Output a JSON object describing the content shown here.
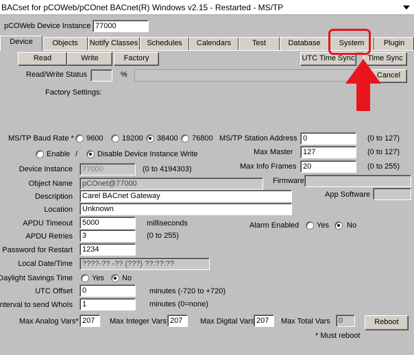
{
  "window": {
    "title": "BACset for pCOWeb/pCOnet BACnet(R)  Windows v2.15  - Restarted - MS/TP"
  },
  "header": {
    "instance_label": "pCOWeb Device Instance",
    "instance_value": "77000"
  },
  "tabs": [
    "Device",
    "Objects",
    "Notify Classes",
    "Schedules",
    "Calendars",
    "Test",
    "Database",
    "System",
    "Plugin"
  ],
  "toolbar": {
    "read": "Read",
    "write": "Write",
    "factory": "Factory",
    "utc_time_sync": "UTC Time Sync",
    "time_sync": "Time Sync",
    "cancel": "Cancel"
  },
  "status": {
    "rw_label": "Read/Write Status",
    "percent": "%",
    "factory_settings": "Factory Settings:"
  },
  "baud": {
    "label": "MS/TP Baud Rate *",
    "options": [
      "9600",
      "19200",
      "38400",
      "76800"
    ],
    "selected": "38400"
  },
  "write_mode": {
    "enable": "Enable",
    "slash": "/",
    "disable": "Disable Device Instance Write"
  },
  "mstp": {
    "station_label": "MS/TP Station Address",
    "station_value": "0",
    "station_range": "(0 to 127)",
    "max_master_label": "Max Master",
    "max_master_value": "127",
    "max_master_range": "(0 to 127)",
    "max_info_label": "Max Info Frames",
    "max_info_value": "20",
    "max_info_range": "(0 to 255)"
  },
  "fields": {
    "device_instance_label": "Device Instance",
    "device_instance_value": "77000",
    "device_instance_range": "(0 to 4194303)",
    "object_name_label": "Object Name",
    "object_name_value": "pCOnet@77000",
    "firmware_label": "Firmware",
    "description_label": "Description",
    "description_value": "Carel BACnet Gateway",
    "app_software_label": "App Software",
    "location_label": "Location",
    "location_value": "Unknown",
    "apdu_timeout_label": "APDU Timeout",
    "apdu_timeout_value": "5000",
    "apdu_timeout_unit": "milliseconds",
    "alarm_enabled_label": "Alarm Enabled",
    "yes": "Yes",
    "no": "No",
    "apdu_retries_label": "APDU Retries",
    "apdu_retries_value": "3",
    "apdu_retries_range": "(0 to 255)",
    "password_label": "Password for Restart",
    "password_value": "1234",
    "local_datetime_label": "Local Date/Time",
    "local_datetime_value": "????-?? -?? (???) ??:??:??",
    "dst_label": "Daylight Savings Time",
    "utc_offset_label": "UTC Offset",
    "utc_offset_value": "0",
    "utc_offset_range": "minutes (-720 to +720)",
    "whois_label": "Interval to send WhoIs",
    "whois_value": "1",
    "whois_range": "minutes (0=none)"
  },
  "maxvars": {
    "analog_label": "Max Analog Vars*",
    "analog_value": "207",
    "integer_label": "Max Integer Vars*",
    "integer_value": "207",
    "digital_label": "Max Digital Vars*",
    "digital_value": "207",
    "total_label": "Max Total Vars",
    "total_value": "0",
    "reboot": "Reboot",
    "must_reboot": "* Must reboot"
  },
  "annotation": {
    "highlight_color": "#e8141e"
  }
}
